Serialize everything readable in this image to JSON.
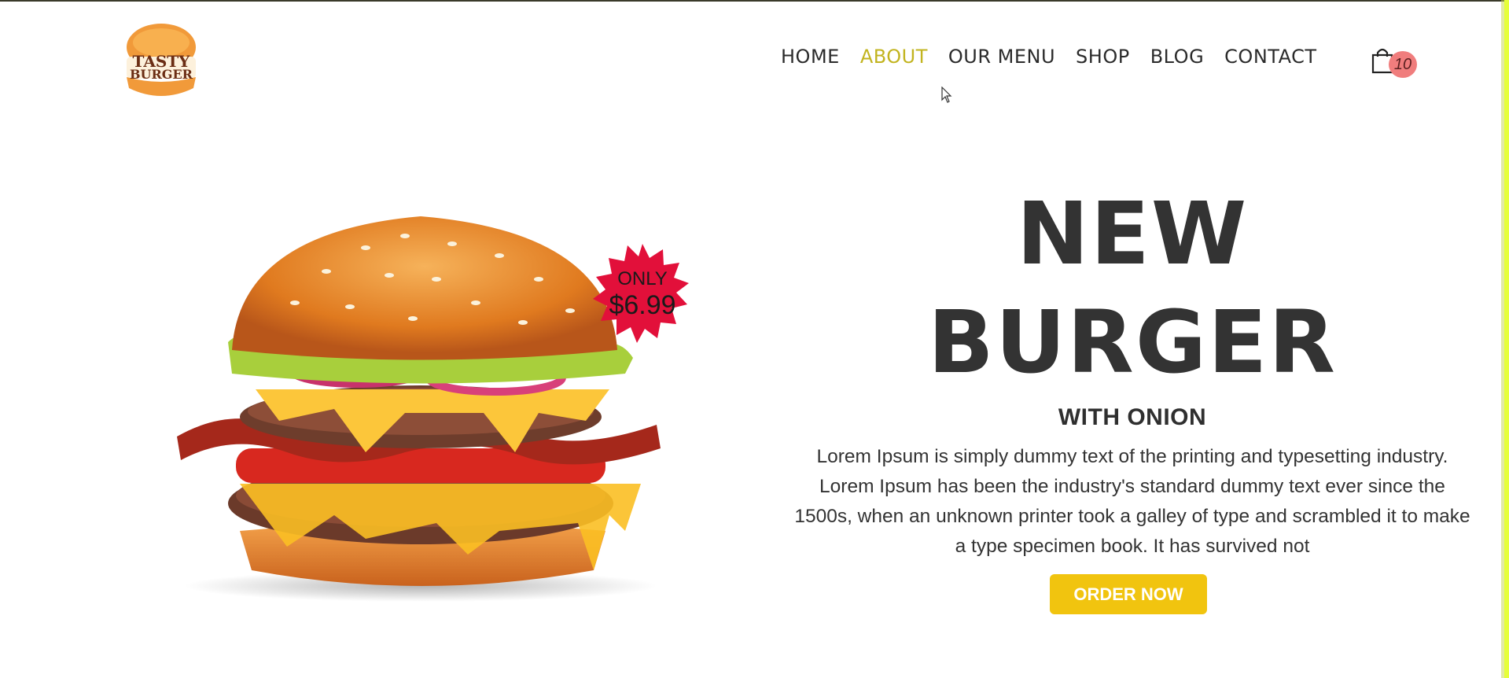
{
  "brand": {
    "logo_line1": "TASTY",
    "logo_line2": "BURGER"
  },
  "nav": {
    "items": [
      {
        "label": "HOME"
      },
      {
        "label": "ABOUT",
        "active": true
      },
      {
        "label": "OUR MENU"
      },
      {
        "label": "SHOP"
      },
      {
        "label": "BLOG"
      },
      {
        "label": "CONTACT"
      }
    ],
    "cart_count": "10"
  },
  "hero": {
    "badge_only": "ONLY",
    "badge_price": "$6.99",
    "title_line1": "NEW",
    "title_line2": "BURGER",
    "subtitle": "WITH ONION",
    "description": "Lorem Ipsum is simply dummy text of the printing and typesetting industry. Lorem Ipsum has been the industry's standard dummy text ever since the 1500s, when an unknown printer took a galley of type and scrambled it to make a type specimen book. It has survived not",
    "cta_label": "ORDER NOW"
  },
  "icons": {
    "cart": "shopping-bag-icon",
    "cursor": "mouse-pointer-icon"
  },
  "colors": {
    "accent": "#c2b41f",
    "button": "#f1c40f",
    "badge": "#e2103a",
    "cart_badge": "#f07d7d",
    "text": "#333333"
  }
}
